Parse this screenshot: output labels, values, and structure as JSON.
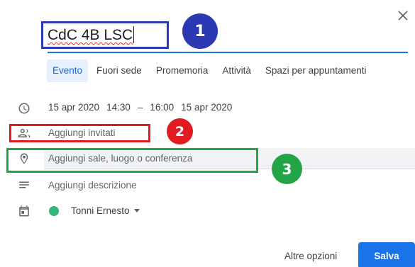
{
  "dialog": {
    "close_icon": "close-icon",
    "title_value": "CdC 4B LSC",
    "tabs": [
      {
        "label": "Evento",
        "active": true
      },
      {
        "label": "Fuori sede",
        "active": false
      },
      {
        "label": "Promemoria",
        "active": false
      },
      {
        "label": "Attività",
        "active": false
      },
      {
        "label": "Spazi per appuntamenti",
        "active": false
      }
    ],
    "datetime": {
      "start_date": "15 apr 2020",
      "start_time": "14:30",
      "separator": "–",
      "end_time": "16:00",
      "end_date": "15 apr 2020"
    },
    "guests_placeholder": "Aggiungi invitati",
    "location_placeholder": "Aggiungi sale, luogo o conferenza",
    "description_placeholder": "Aggiungi descrizione",
    "calendar": {
      "owner": "Tonni Ernesto",
      "color": "#33b679"
    },
    "footer": {
      "more_options": "Altre opzioni",
      "save": "Salva"
    }
  },
  "annotations": {
    "labels": [
      "1",
      "2",
      "3"
    ],
    "colors": {
      "blue": "#2b39b3",
      "red": "#e11b22",
      "green": "#22a447"
    }
  }
}
